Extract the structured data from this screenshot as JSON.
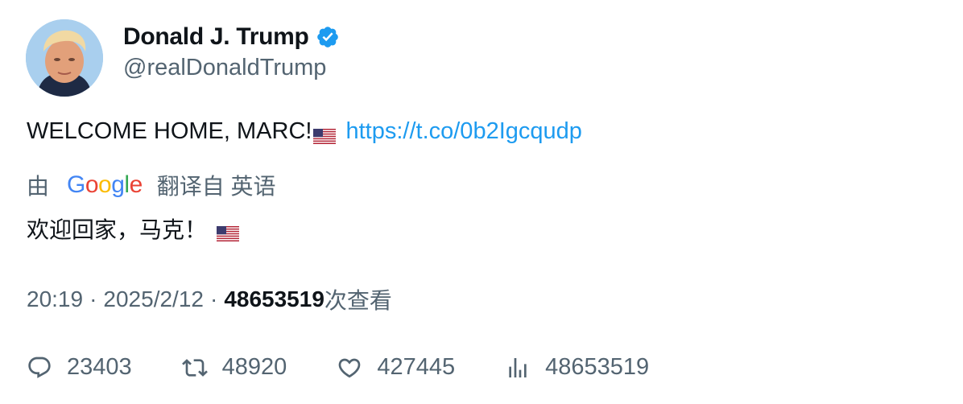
{
  "author": {
    "display_name": "Donald J. Trump",
    "handle": "@realDonaldTrump",
    "verified_icon": "verified-badge-icon",
    "avatar_icon": "profile-avatar"
  },
  "tweet": {
    "text": "WELCOME HOME, MARC!",
    "link": "https://t.co/0b2Igcqudp"
  },
  "translation": {
    "prefix": "由",
    "provider": "Google",
    "suffix": "翻译自 英语",
    "text": "欢迎回家，马克！"
  },
  "meta": {
    "time": "20:19",
    "date": "2025/2/12",
    "views": "48653519",
    "views_label": "次查看"
  },
  "actions": {
    "replies": "23403",
    "retweets": "48920",
    "likes": "427445",
    "views": "48653519"
  },
  "colors": {
    "link": "#1d9bf0",
    "secondary_text": "#536471",
    "primary_text": "#0f1419",
    "verified": "#1d9bf0"
  }
}
